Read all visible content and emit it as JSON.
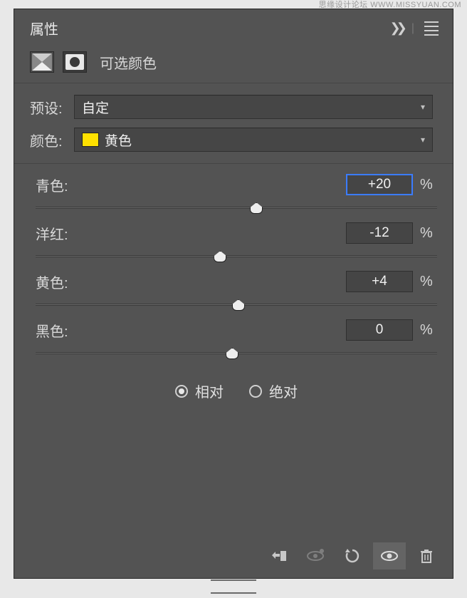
{
  "watermark": "思缘设计论坛  WWW.MISSYUAN.COM",
  "panel": {
    "title": "属性",
    "adjustment_label": "可选颜色"
  },
  "preset": {
    "label": "预设:",
    "value": "自定"
  },
  "color": {
    "label": "颜色:",
    "value": "黄色",
    "swatch": "#ffe100"
  },
  "sliders": {
    "cyan": {
      "label": "青色:",
      "value": "+20",
      "pos": 55
    },
    "magenta": {
      "label": "洋红:",
      "value": "-12",
      "pos": 46
    },
    "yellow": {
      "label": "黄色:",
      "value": "+4",
      "pos": 50.5
    },
    "black": {
      "label": "黑色:",
      "value": "0",
      "pos": 49
    }
  },
  "mode": {
    "relative": "相对",
    "absolute": "绝对",
    "selected": "relative"
  },
  "percent": "%"
}
